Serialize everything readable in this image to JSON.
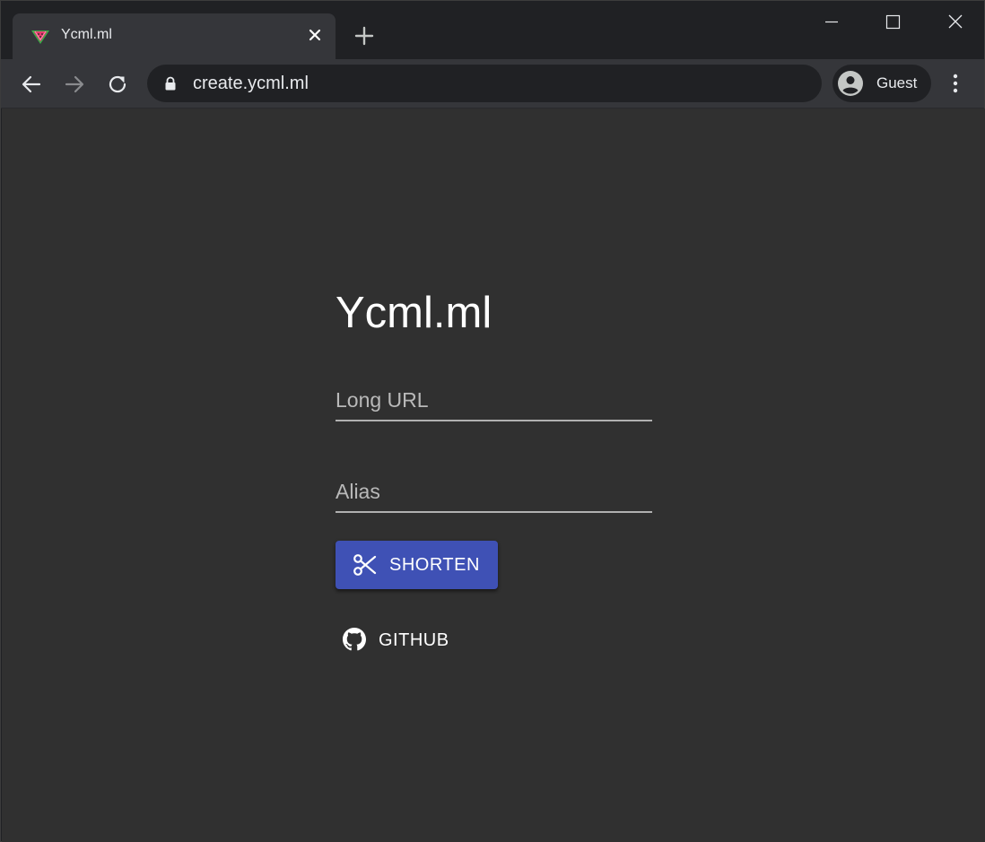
{
  "browser": {
    "tab": {
      "title": "Ycml.ml",
      "favicon": "watermelon-icon"
    },
    "address_bar": {
      "url": "create.ycml.ml",
      "secure_icon": "lock-icon"
    },
    "profile": {
      "label": "Guest",
      "icon": "account-circle-icon"
    },
    "colors": {
      "frame": "#202124",
      "toolbar": "#35363a",
      "text": "#e8eaed"
    }
  },
  "page": {
    "title": "Ycml.ml",
    "long_url_field": {
      "placeholder": "Long URL",
      "value": ""
    },
    "alias_field": {
      "placeholder": "Alias",
      "value": ""
    },
    "shorten_button": {
      "label": "SHORTEN",
      "icon": "scissors-icon"
    },
    "github_button": {
      "label": "GITHUB",
      "icon": "github-icon"
    },
    "colors": {
      "background": "#303030",
      "primary": "#3f51b5",
      "text": "#ffffff"
    }
  }
}
